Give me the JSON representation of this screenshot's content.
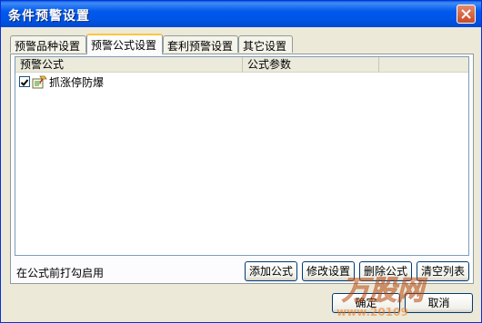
{
  "window": {
    "title": "条件预警设置"
  },
  "tabs": [
    {
      "label": "预警品种设置"
    },
    {
      "label": "预警公式设置"
    },
    {
      "label": "套利预警设置"
    },
    {
      "label": "其它设置"
    }
  ],
  "list": {
    "columns": [
      "预警公式",
      "公式参数"
    ],
    "rows": [
      {
        "checked": true,
        "name": "抓涨停防爆",
        "params": ""
      }
    ]
  },
  "hint": "在公式前打勾启用",
  "buttons": {
    "add": "添加公式",
    "modify": "修改设置",
    "delete": "删除公式",
    "clear": "清空列表",
    "ok": "确定",
    "cancel": "取消"
  },
  "watermark": {
    "logo_text": "万股网",
    "url_text": "www.20109"
  }
}
